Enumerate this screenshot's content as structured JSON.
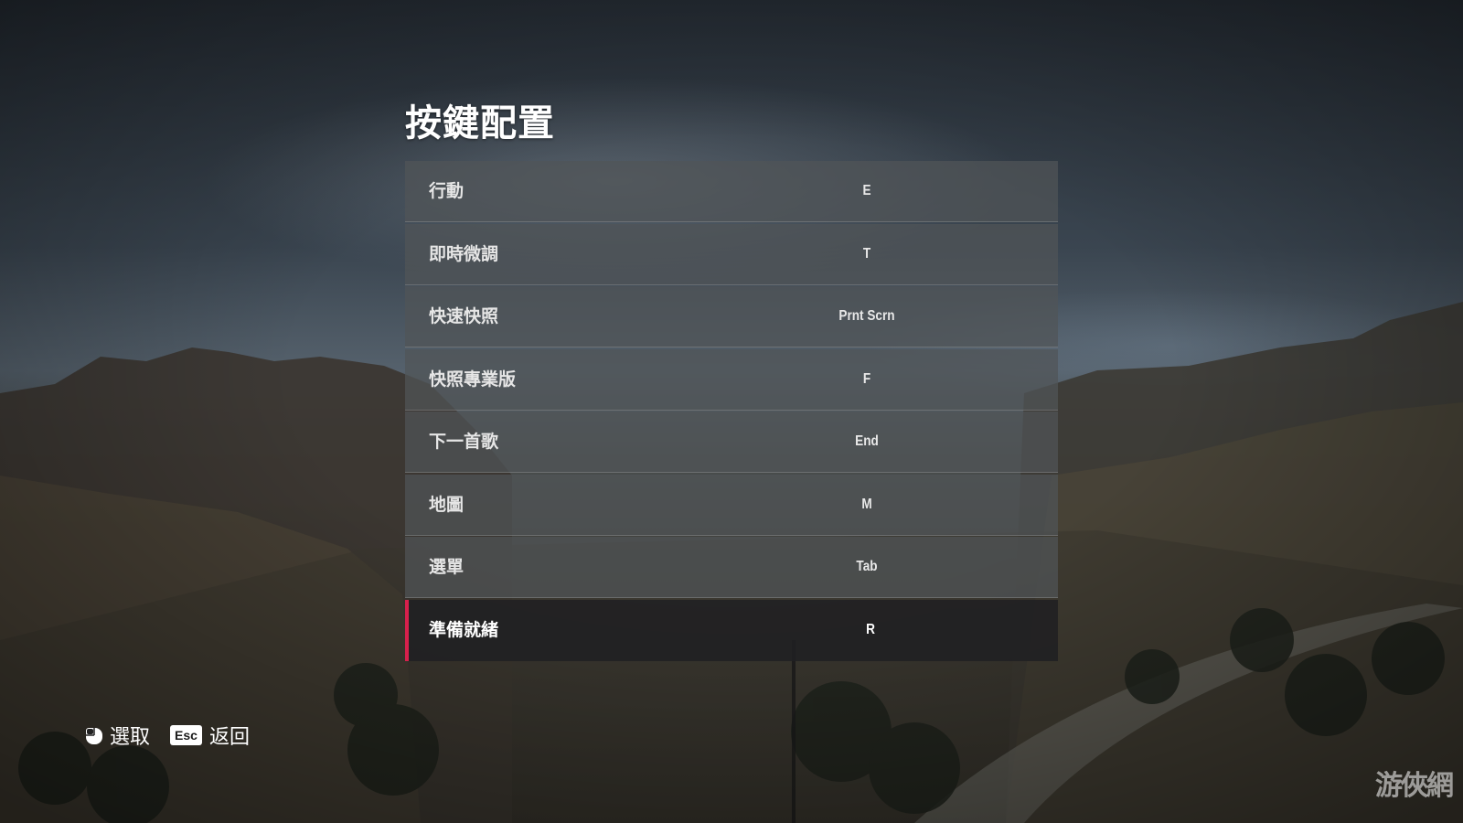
{
  "screen": {
    "title": "按鍵配置"
  },
  "bindings": [
    {
      "action": "行動",
      "key": "E",
      "selected": false
    },
    {
      "action": "即時微調",
      "key": "T",
      "selected": false
    },
    {
      "action": "快速快照",
      "key": "Prnt Scrn",
      "selected": false
    },
    {
      "action": "快照專業版",
      "key": "F",
      "selected": false
    },
    {
      "action": "下一首歌",
      "key": "End",
      "selected": false
    },
    {
      "action": "地圖",
      "key": "M",
      "selected": false
    },
    {
      "action": "選單",
      "key": "Tab",
      "selected": false
    },
    {
      "action": "準備就緒",
      "key": "R",
      "selected": true
    }
  ],
  "footer": {
    "select": {
      "icon": "mouse-left-click-icon",
      "label": "選取"
    },
    "back": {
      "key": "Esc",
      "label": "返回"
    }
  },
  "watermark": "游俠網",
  "colors": {
    "accent": "#d8204c",
    "row_bg": "#505458",
    "selected_row_bg": "#202022"
  }
}
